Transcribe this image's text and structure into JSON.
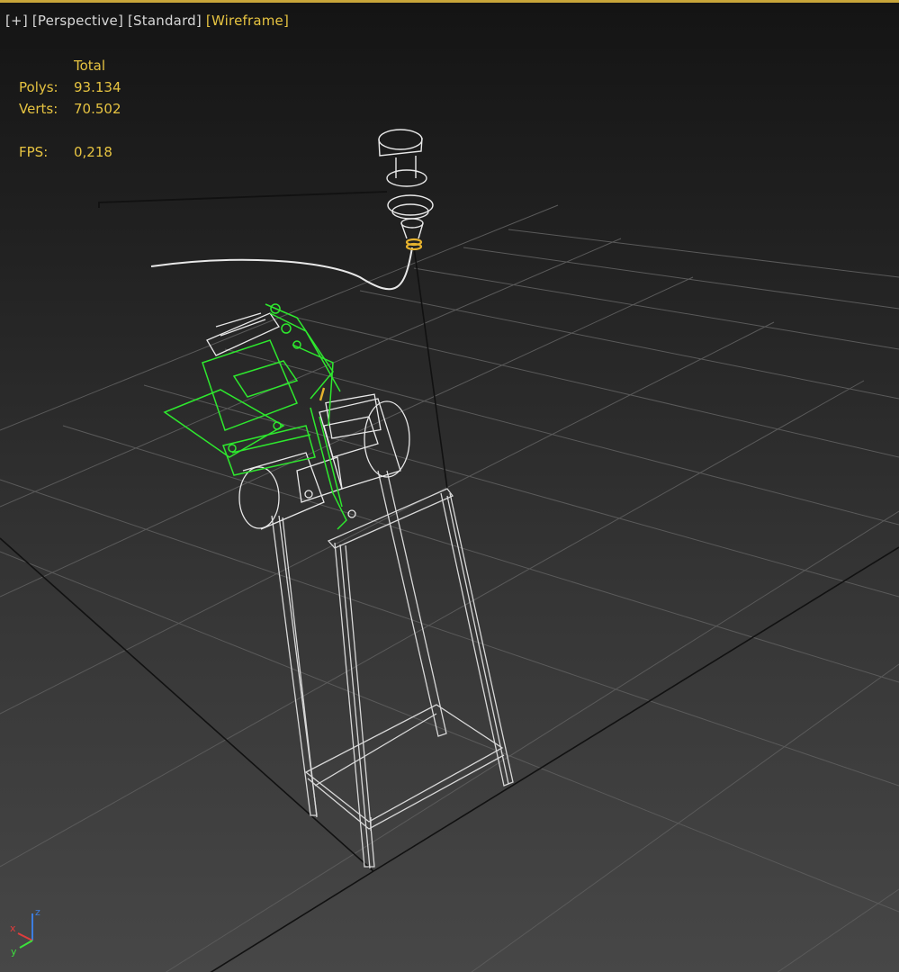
{
  "viewport": {
    "labels": {
      "menu": "[+]",
      "view": "[Perspective]",
      "shading": "[Standard]",
      "display": "[Wireframe]"
    },
    "stats": {
      "header": "Total",
      "polys_label": "Polys:",
      "polys_value": "93.134",
      "verts_label": "Verts:",
      "verts_value": "70.502",
      "fps_label": "FPS:",
      "fps_value": "0,218"
    },
    "gizmo": {
      "x": "x",
      "y": "y",
      "z": "z"
    }
  },
  "colors": {
    "active_border": "#c8a53a",
    "overlay_text": "#e6c341",
    "grid_line": "#5a5a5a",
    "wireframe_white": "#e8e8e8",
    "wireframe_selected": "#2ee82e",
    "axis_x": "#e03c3c",
    "axis_y": "#3ce03c",
    "axis_z": "#3c7de0"
  }
}
